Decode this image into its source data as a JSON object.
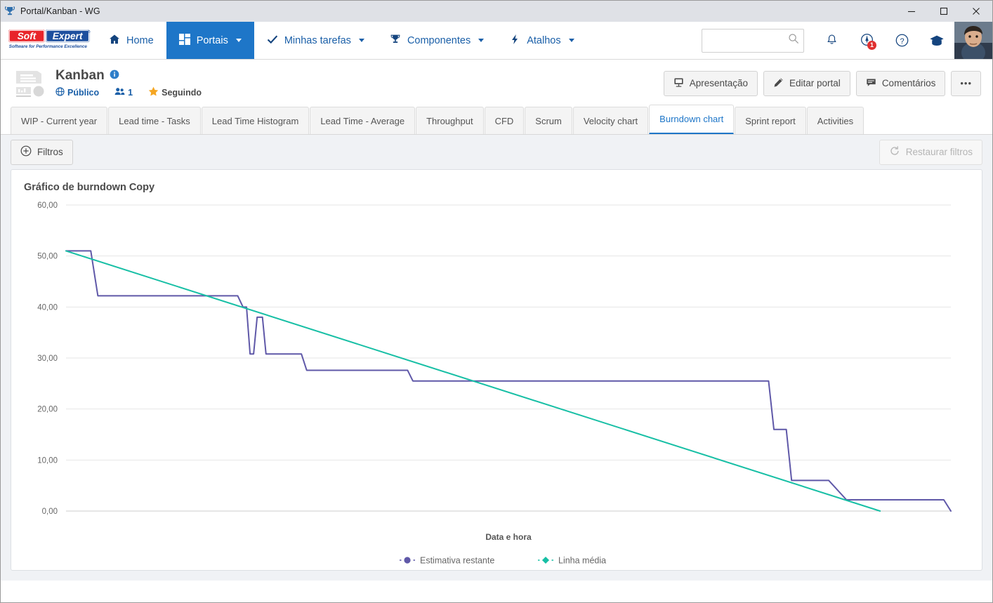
{
  "window": {
    "title": "Portal/Kanban - WG",
    "icon": "trophy-icon",
    "minimize": "–",
    "maximize": "□",
    "close": "✕"
  },
  "brand": {
    "name_part1": "Soft",
    "name_part2": "Expert",
    "tagline": "Software for Performance Excellence",
    "registered": "®"
  },
  "topnav": {
    "items": [
      {
        "label": "Home",
        "icon": "home-icon",
        "has_caret": false,
        "active": false
      },
      {
        "label": "Portais",
        "icon": "grid-icon",
        "has_caret": true,
        "active": true
      },
      {
        "label": "Minhas tarefas",
        "icon": "check-icon",
        "has_caret": true,
        "active": false
      },
      {
        "label": "Componentes",
        "icon": "trophy-icon",
        "has_caret": true,
        "active": false
      },
      {
        "label": "Atalhos",
        "icon": "bolt-icon",
        "has_caret": true,
        "active": false
      }
    ],
    "search": {
      "value": "",
      "placeholder": ""
    },
    "notification_badge": "1"
  },
  "portal": {
    "title": "Kanban",
    "visibility": "Público",
    "members_count": "1",
    "following": "Seguindo",
    "actions": [
      {
        "label": "Apresentação",
        "icon": "presentation-icon"
      },
      {
        "label": "Editar portal",
        "icon": "pencil-icon"
      },
      {
        "label": "Comentários",
        "icon": "comment-icon"
      },
      {
        "label": "•••",
        "icon": "more-icon"
      }
    ]
  },
  "tabs": [
    {
      "label": "WIP - Current year",
      "active": false
    },
    {
      "label": "Lead time - Tasks",
      "active": false
    },
    {
      "label": "Lead Time Histogram",
      "active": false
    },
    {
      "label": "Lead Time - Average",
      "active": false
    },
    {
      "label": "Throughput",
      "active": false
    },
    {
      "label": "CFD",
      "active": false
    },
    {
      "label": "Scrum",
      "active": false
    },
    {
      "label": "Velocity chart",
      "active": false
    },
    {
      "label": "Burndown chart",
      "active": true
    },
    {
      "label": "Sprint report",
      "active": false
    },
    {
      "label": "Activities",
      "active": false
    }
  ],
  "filterbar": {
    "filters_label": "Filtros",
    "filters_icon": "plus-circle-icon",
    "restore_label": "Restaurar filtros",
    "restore_icon": "refresh-icon",
    "restore_disabled": true
  },
  "chart_data": {
    "type": "line",
    "title": "Gráfico de burndown Copy",
    "xlabel": "Data e hora",
    "ylabel": "",
    "ylim": [
      0,
      60
    ],
    "yticks": [
      "0,00",
      "10,00",
      "20,00",
      "30,00",
      "40,00",
      "50,00",
      "60,00"
    ],
    "ytick_values": [
      0,
      10,
      20,
      30,
      40,
      50,
      60
    ],
    "xticks": [],
    "grid": true,
    "legend_position": "bottom",
    "colors": {
      "remaining": "#5f58a8",
      "average": "#17bfa5",
      "grid": "#e6e6e6",
      "axis": "#cccccc"
    },
    "series": [
      {
        "name": "Estimativa restante",
        "marker": "circle",
        "color": "#5f58a8",
        "step": true,
        "x": [
          0,
          2.8,
          3.6,
          18.6,
          19.4,
          20.0,
          20.4,
          20.8,
          21.2,
          21.6,
          22.2,
          22.6,
          23.0,
          26.6,
          27.2,
          38.6,
          39.2,
          79.4,
          80.0,
          81.4,
          82.0,
          85.4,
          86.2,
          88.2,
          89.0,
          99.2,
          100.0
        ],
        "y": [
          51.0,
          51.0,
          42.2,
          42.2,
          42.2,
          40.0,
          40.0,
          30.8,
          30.8,
          38.0,
          38.0,
          30.8,
          30.8,
          30.8,
          27.6,
          27.6,
          25.5,
          25.5,
          16.0,
          16.0,
          6.0,
          6.0,
          6.0,
          2.2,
          2.2,
          2.2,
          0.0
        ]
      },
      {
        "name": "Linha média",
        "marker": "diamond",
        "color": "#17bfa5",
        "step": false,
        "x": [
          0,
          92.0
        ],
        "y": [
          51.0,
          0.0
        ]
      }
    ]
  }
}
